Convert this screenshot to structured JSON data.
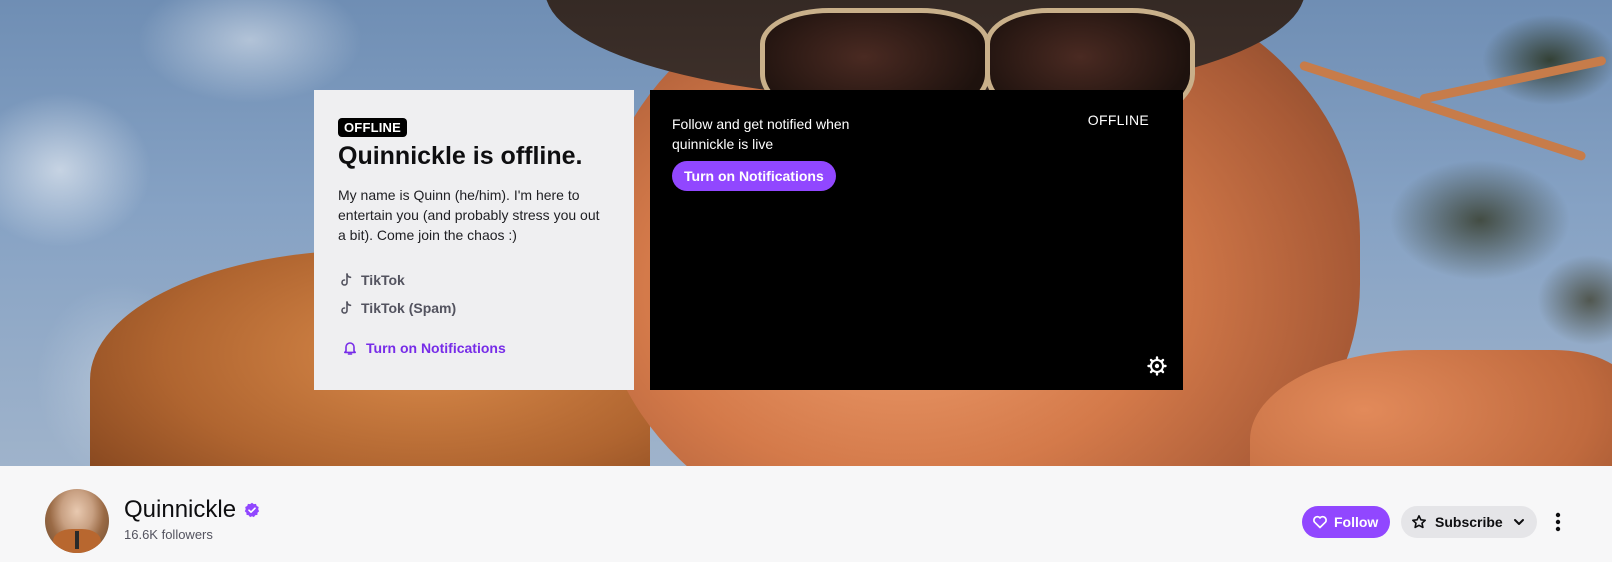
{
  "colors": {
    "accent": "#9147ff",
    "accent_text": "#772ce8",
    "player_bg": "#000000",
    "card_bg": "#efeff1"
  },
  "info_card": {
    "badge": "OFFLINE",
    "title": "Quinnickle is offline.",
    "bio": "My name is Quinn (he/him). I'm here to entertain you (and probably stress you out a bit). Come join the chaos :)",
    "social_links": [
      {
        "icon": "tiktok-icon",
        "label": "TikTok"
      },
      {
        "icon": "tiktok-icon",
        "label": "TikTok (Spam)"
      }
    ],
    "notification_link": {
      "icon": "bell-icon",
      "label": "Turn on Notifications"
    }
  },
  "player": {
    "message": "Follow and get notified when quinnickle is live",
    "button_label": "Turn on Notifications",
    "status": "OFFLINE",
    "settings_icon": "gear-icon"
  },
  "channel": {
    "name": "Quinnickle",
    "verified_icon": "verified-badge-icon",
    "followers": "16.6K followers",
    "follow_label": "Follow",
    "follow_icon": "heart-icon",
    "subscribe_label": "Subscribe",
    "subscribe_icon": "star-icon",
    "more_icon": "more-vertical-icon"
  }
}
